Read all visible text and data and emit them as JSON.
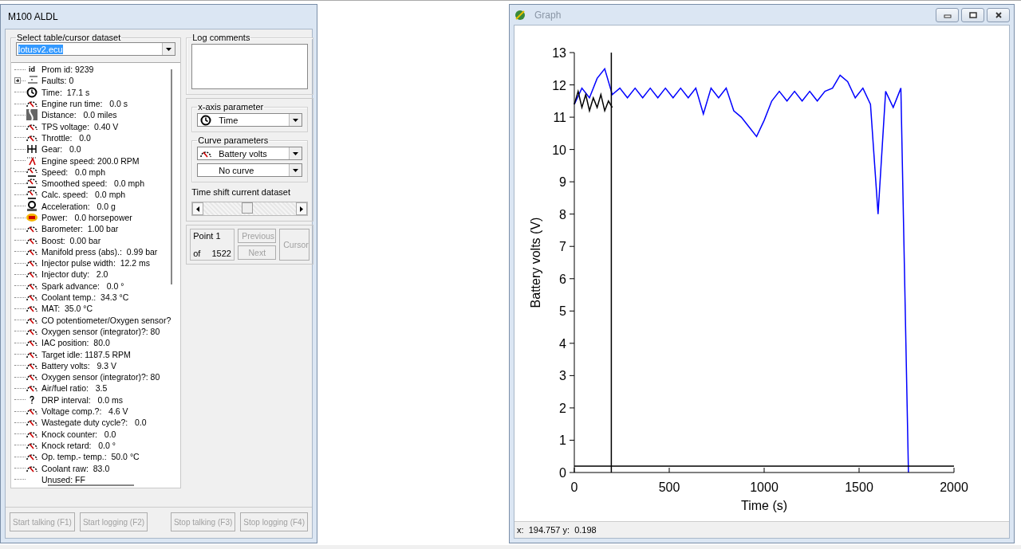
{
  "main_window": {
    "title": "M100 ALDL",
    "dataset_group": {
      "legend": "Select table/cursor dataset",
      "value": "lotusv2.ecu"
    },
    "tree": [
      {
        "kind": "id",
        "label": "Prom id: 9239"
      },
      {
        "kind": "bits",
        "label": "Faults: 0",
        "expanded": false
      },
      {
        "kind": "clock",
        "label": "Time:  17.1 s"
      },
      {
        "kind": "gauge",
        "label": "Engine run time:   0.0 s"
      },
      {
        "kind": "road",
        "label": "Distance:   0.0 miles"
      },
      {
        "kind": "gauge",
        "label": "TPS voltage:  0.40 V"
      },
      {
        "kind": "gauge",
        "label": "Throttle:   0.0"
      },
      {
        "kind": "gear",
        "label": "Gear:   0.0"
      },
      {
        "kind": "tach",
        "label": "Engine speed: 200.0 RPM"
      },
      {
        "kind": "speedo",
        "label": "Speed:   0.0 mph"
      },
      {
        "kind": "speedo",
        "label": "Smoothed speed:   0.0 mph"
      },
      {
        "kind": "speedo",
        "label": "Calc. speed:   0.0 mph"
      },
      {
        "kind": "accel",
        "label": "Acceleration:   0.0 g"
      },
      {
        "kind": "power",
        "label": "Power:   0.0 horsepower"
      },
      {
        "kind": "gauge",
        "label": "Barometer:  1.00 bar"
      },
      {
        "kind": "gauge",
        "label": "Boost:  0.00 bar"
      },
      {
        "kind": "gauge",
        "label": "Manifold press (abs).:  0.99 bar"
      },
      {
        "kind": "gauge",
        "label": "Injector pulse width:  12.2 ms"
      },
      {
        "kind": "gauge",
        "label": "Injector duty:   2.0"
      },
      {
        "kind": "gauge",
        "label": "Spark advance:   0.0 °"
      },
      {
        "kind": "gauge",
        "label": "Coolant temp.:  34.3 °C"
      },
      {
        "kind": "gauge",
        "label": "MAT:  35.0 °C"
      },
      {
        "kind": "gauge",
        "label": "CO potentiometer/Oxygen sensor?"
      },
      {
        "kind": "gauge",
        "label": "Oxygen sensor (integrator)?: 80"
      },
      {
        "kind": "gauge",
        "label": "IAC position:  80.0"
      },
      {
        "kind": "gauge",
        "label": "Target idle: 1187.5 RPM"
      },
      {
        "kind": "gauge",
        "label": "Battery volts:   9.3 V"
      },
      {
        "kind": "gauge",
        "label": "Oxygen sensor (integrator)?: 80"
      },
      {
        "kind": "gauge",
        "label": "Air/fuel ratio:   3.5"
      },
      {
        "kind": "unknown",
        "label": "DRP interval:   0.0 ms"
      },
      {
        "kind": "gauge",
        "label": "Voltage comp.?:   4.6 V"
      },
      {
        "kind": "gauge",
        "label": "Wastegate duty cycle?:   0.0"
      },
      {
        "kind": "gauge",
        "label": "Knock counter:   0.0"
      },
      {
        "kind": "gauge",
        "label": "Knock retard:   0.0 °"
      },
      {
        "kind": "gauge",
        "label": "Op. temp.- temp.:  50.0 °C"
      },
      {
        "kind": "gauge",
        "label": "Coolant raw:  83.0"
      },
      {
        "kind": "blank",
        "label": "Unused: FF"
      }
    ],
    "log_group": {
      "legend": "Log comments"
    },
    "x_axis_group": {
      "legend": "x-axis parameter",
      "value": "Time",
      "kind": "clock"
    },
    "curve_group": {
      "legend": "Curve parameters",
      "curves": [
        {
          "value": "Battery volts",
          "kind": "gauge"
        },
        {
          "value": "No curve",
          "kind": "blank"
        }
      ]
    },
    "time_shift": {
      "label": "Time shift current dataset",
      "level": 0.47
    },
    "point": {
      "label": "Point 1",
      "of_label": "of",
      "count": "1522"
    },
    "point_buttons": [
      {
        "label": "Previous",
        "disabled": true
      },
      {
        "label": "Next",
        "disabled": true
      }
    ],
    "cursor_button": {
      "label": "Cursor",
      "disabled": true
    },
    "buttons": [
      {
        "label": "Start talking (F1)",
        "disabled": true
      },
      {
        "label": "Start logging (F2)",
        "disabled": true
      },
      {
        "label": "Stop talking (F3)",
        "disabled": true
      },
      {
        "label": "Stop logging (F4)",
        "disabled": true
      }
    ]
  },
  "graph_window": {
    "title": "Graph",
    "active": false,
    "chart_data": {
      "type": "line",
      "xlabel": "Time (s)",
      "ylabel": "Battery volts (V)",
      "xlim": [
        0,
        2000
      ],
      "ylim": [
        0,
        13
      ],
      "xticks": [
        0,
        500,
        1000,
        1500,
        2000
      ],
      "yticks": [
        0,
        1,
        2,
        3,
        4,
        5,
        6,
        7,
        8,
        9,
        10,
        11,
        12,
        13
      ],
      "series": [
        {
          "color": "#0000ff",
          "x": [
            0,
            40,
            80,
            120,
            160,
            200,
            240,
            280,
            320,
            360,
            400,
            440,
            480,
            520,
            560,
            600,
            640,
            680,
            720,
            760,
            800,
            840,
            880,
            920,
            960,
            1000,
            1040,
            1080,
            1120,
            1160,
            1200,
            1240,
            1280,
            1320,
            1360,
            1400,
            1440,
            1480,
            1520,
            1560,
            1600,
            1640,
            1680,
            1720,
            1760
          ],
          "values": [
            11.4,
            11.9,
            11.6,
            12.2,
            12.5,
            11.7,
            11.9,
            11.6,
            11.9,
            11.6,
            11.9,
            11.6,
            11.9,
            11.6,
            11.9,
            11.6,
            11.9,
            11.1,
            11.9,
            11.6,
            11.9,
            11.2,
            11.0,
            10.7,
            10.4,
            10.9,
            11.5,
            11.8,
            11.5,
            11.8,
            11.5,
            11.8,
            11.5,
            11.8,
            11.9,
            12.3,
            12.1,
            11.6,
            11.9,
            11.4,
            8.0,
            11.8,
            11.3,
            11.9,
            0
          ]
        },
        {
          "color": "#000000",
          "x": [
            0,
            20,
            40,
            60,
            80,
            100,
            120,
            140,
            160,
            180,
            200
          ],
          "values": [
            11.4,
            11.8,
            11.3,
            11.7,
            11.2,
            11.6,
            11.3,
            11.7,
            11.2,
            11.5,
            11.3
          ]
        },
        {
          "color": "#000000",
          "x": [
            194.757,
            194.757
          ],
          "values": [
            0,
            13
          ]
        },
        {
          "color": "#000000",
          "x": [
            0,
            2000
          ],
          "values": [
            0.198,
            0.198
          ]
        }
      ]
    },
    "status": "x:  194.757 y:  0.198"
  }
}
